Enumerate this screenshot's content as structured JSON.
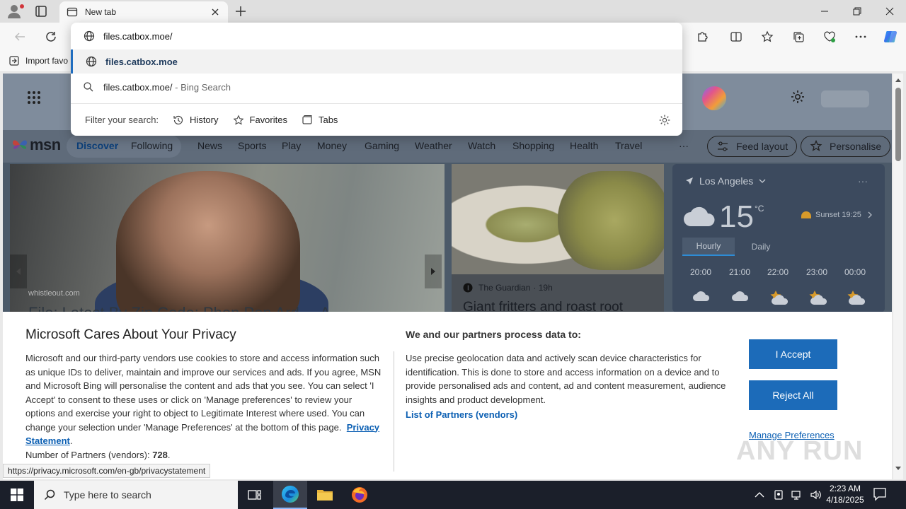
{
  "browser": {
    "tab": {
      "title": "New tab"
    },
    "address": {
      "value": "files.catbox.moe/"
    },
    "suggestions": [
      {
        "text": "files.catbox.moe"
      },
      {
        "text": "files.catbox.moe/",
        "suffix": " - Bing Search"
      }
    ],
    "filter": {
      "label": "Filter your search:",
      "chips": [
        "History",
        "Favorites",
        "Tabs"
      ]
    },
    "bookmarks": {
      "import_label": "Import favo"
    }
  },
  "msn": {
    "logo_text": "msn",
    "nav": [
      "Discover",
      "Following",
      "News",
      "Sports",
      "Play",
      "Money",
      "Gaming",
      "Weather",
      "Watch",
      "Shopping",
      "Health",
      "Travel"
    ],
    "more": "···",
    "feed_layout": "Feed layout",
    "personalise": "Personalise",
    "hero": {
      "source": "whistleout.com",
      "title": "File: Latest By Zip Code: Phon Pop Ard ... A"
    },
    "card2": {
      "source": "The Guardian",
      "time": "· 19h",
      "title": "Giant fritters and roast root"
    },
    "weather": {
      "location": "Los Angeles",
      "more": "···",
      "temp": "15",
      "unit": "°C",
      "sunset": "Sunset 19:25",
      "tabs": [
        "Hourly",
        "Daily"
      ],
      "hours": [
        "20:00",
        "21:00",
        "22:00",
        "23:00",
        "00:00"
      ]
    }
  },
  "privacy": {
    "title": "Microsoft Cares About Your Privacy",
    "body": "Microsoft and our third-party vendors use cookies to store and access information such as unique IDs to deliver, maintain and improve our services and ads. If you agree, MSN and Microsoft Bing will personalise the content and ads that you see. You can select 'I Accept' to consent to these uses or click on 'Manage preferences' to review your options and exercise your right to object to Legitimate Interest where used.  You can change your selection under 'Manage Preferences' at the bottom of this page.",
    "privacy_link": "Privacy Statement",
    "partners_label": "Number of Partners (vendors):",
    "partners_count": "728",
    "right_title": "We and our partners process data to:",
    "right_body": "Use precise geolocation data and actively scan device characteristics for identification. This is done to store and access information on a device and to provide personalised ads and content, ad and content measurement, audience insights and product development.",
    "vendors_link": "List of Partners (vendors)",
    "accept": "I Accept",
    "reject": "Reject All",
    "manage": "Manage Preferences"
  },
  "status_url": "https://privacy.microsoft.com/en-gb/privacystatement",
  "watermark": "ANY RUN",
  "taskbar": {
    "search_placeholder": "Type here to search",
    "time": "2:23 AM",
    "date": "4/18/2025"
  },
  "colors": {
    "accent": "#1c6bb9",
    "link": "#0b5fb3"
  }
}
